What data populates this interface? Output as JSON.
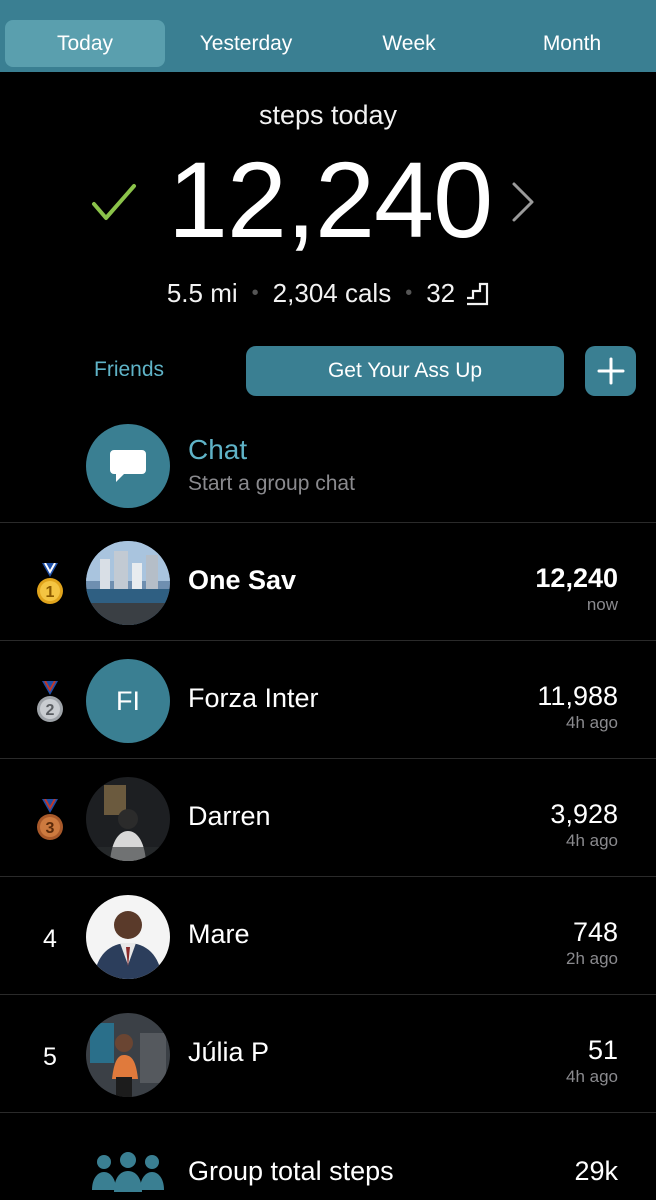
{
  "tabs": [
    {
      "label": "Today",
      "active": true
    },
    {
      "label": "Yesterday",
      "active": false
    },
    {
      "label": "Week",
      "active": false
    },
    {
      "label": "Month",
      "active": false
    }
  ],
  "hero": {
    "label": "steps today",
    "steps": "12,240",
    "distance": "5.5 mi",
    "calories": "2,304 cals",
    "floors": "32",
    "goal_reached_icon": "check-icon",
    "accent_check": "#8bc34a"
  },
  "actions": {
    "friends_label": "Friends",
    "cta_label": "Get Your Ass Up",
    "add_icon": "plus-icon"
  },
  "chat": {
    "title": "Chat",
    "subtitle": "Start a group chat"
  },
  "leaderboard": [
    {
      "rank": "1",
      "medal": "gold",
      "name": "One Sav",
      "steps": "12,240",
      "time": "now",
      "you": true
    },
    {
      "rank": "2",
      "medal": "silver",
      "name": "Forza Inter",
      "initials": "FI",
      "steps": "11,988",
      "time": "4h ago",
      "you": false
    },
    {
      "rank": "3",
      "medal": "bronze",
      "name": "Darren",
      "steps": "3,928",
      "time": "4h ago",
      "you": false
    },
    {
      "rank": "4",
      "name": "Mare",
      "steps": "748",
      "time": "2h ago",
      "you": false
    },
    {
      "rank": "5",
      "name": "Júlia P",
      "steps": "51",
      "time": "4h ago",
      "you": false
    }
  ],
  "group": {
    "label": "Group total steps",
    "total": "29k"
  },
  "colors": {
    "brand": "#3a7f92",
    "brand_light": "#5fb3c7",
    "background": "#000000",
    "muted": "#8a8a8e"
  }
}
